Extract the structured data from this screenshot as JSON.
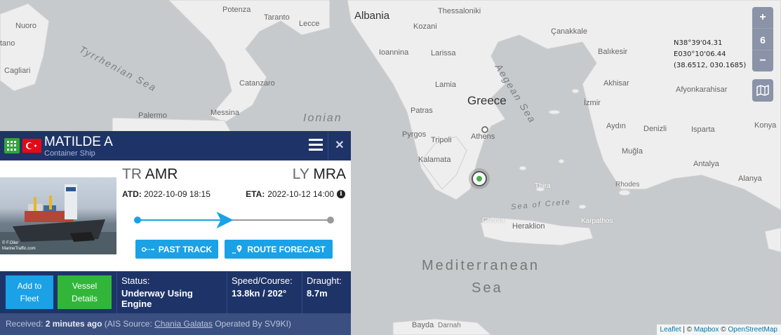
{
  "map": {
    "places": {
      "albania": "Albania",
      "greece": "Greece",
      "potenza": "Potenza",
      "taranto": "Taranto",
      "lecce": "Lecce",
      "nuoro": "Nuoro",
      "tano": "tano",
      "cagliari": "Cagliari",
      "catanzaro": "Catanzaro",
      "palermo": "Palermo",
      "messina": "Messina",
      "ionian": "Ionian",
      "tyrrhenian": "Tyrrhenian Sea",
      "thessaloniki": "Thessaloniki",
      "kozani": "Kozani",
      "ioannina": "Ioannina",
      "larissa": "Larissa",
      "lamia": "Lamia",
      "patras": "Patras",
      "pyrgos": "Pyrgos",
      "tripoli": "Tripoli",
      "kalamata": "Kalamata",
      "athens": "Athens",
      "aegean": "Aegean Sea",
      "canakkale": "Çanakkale",
      "balikesir": "Balıkesir",
      "akhisar": "Akhisar",
      "afyonkarahisar": "Afyonkarahisar",
      "izmir": "İzmir",
      "aydin": "Aydın",
      "denizli": "Denizli",
      "isparta": "Isparta",
      "konya": "Konya",
      "mugla": "Muğla",
      "antalya": "Antalya",
      "alanya": "Alanya",
      "rhodes": "Rhodes",
      "thira": "Thira",
      "sea_crete": "Sea of Crete",
      "chania": "Chania",
      "heraklion": "Heraklion",
      "karpathos": "Karpathos",
      "mediterranean": "Mediterranean",
      "sea": "Sea",
      "bayda": "Bayda",
      "darnah": "Darnah"
    },
    "zoom": {
      "plus": "+",
      "level": "6",
      "minus": "−"
    },
    "coordinates": {
      "lat": "N38°39'04.31",
      "lon": "E030°10'06.44",
      "decimal": "(38.6512, 030.1685)"
    },
    "attribution": {
      "leaflet": "Leaflet",
      "sep1": " | © ",
      "mapbox": "Mapbox",
      "sep2": " © ",
      "osm": "OpenStreetMap"
    }
  },
  "vessel": {
    "name": "MATILDE A",
    "type": "Container Ship",
    "photo_credit_1": "© F.Olier",
    "photo_credit_2": "MarineTraffic.com",
    "from_country": "TR",
    "from_port": "AMR",
    "to_country": "LY",
    "to_port": "MRA",
    "atd_label": "ATD:",
    "atd_value": "2022-10-09 18:15",
    "eta_label": "ETA:",
    "eta_value": "2022-10-12 14:00",
    "voyage_progress": 0.46,
    "past_track_label": "PAST TRACK",
    "route_forecast_label": "ROUTE FORECAST",
    "add_fleet_line1": "Add to",
    "add_fleet_line2": "Fleet",
    "details_line1": "Vessel",
    "details_line2": "Details",
    "status_label": "Status:",
    "status_value": "Underway Using Engine",
    "speed_label": "Speed/Course:",
    "speed_value": "13.8kn / 202°",
    "draught_label": "Draught:",
    "draught_value": "8.7m",
    "received_label": "Received:",
    "received_value": "2 minutes ago",
    "ais_prefix": "(AIS Source:",
    "ais_source": "Chania Galatas",
    "ais_suffix": "Operated By SV9KI)"
  },
  "colors": {
    "panel_header": "#1e3468",
    "accent_blue": "#1aa1e6",
    "accent_green": "#32b63a",
    "flag_red": "#e30a17"
  }
}
